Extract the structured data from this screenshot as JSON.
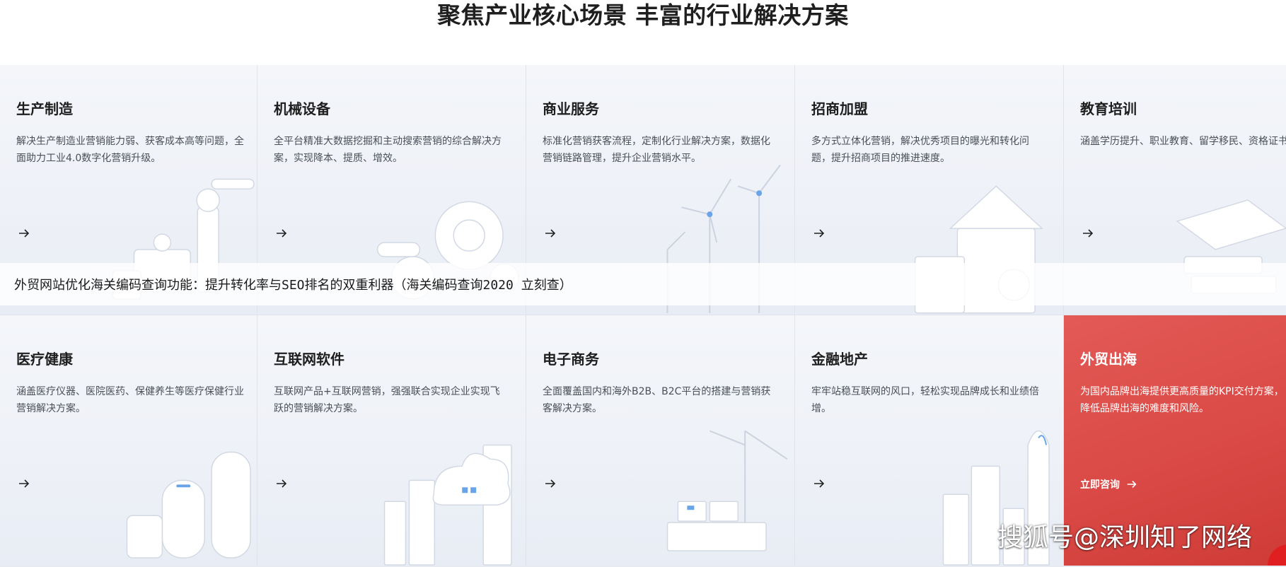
{
  "section": {
    "title": "聚焦产业核心场景 丰富的行业解决方案"
  },
  "cards": [
    {
      "title": "生产制造",
      "desc": "解决生产制造业营销能力弱、获客成本高等问题，全面助力工业4.0数字化营销升级。"
    },
    {
      "title": "机械设备",
      "desc": "全平台精准大数据挖掘和主动搜索营销的综合解决方案，实现降本、提质、增效。"
    },
    {
      "title": "商业服务",
      "desc": "标准化营销获客流程，定制化行业解决方案，数据化营销链路管理，提升企业营销水平。"
    },
    {
      "title": "招商加盟",
      "desc": "多方式立体化营销，解决优秀项目的曝光和转化问题，提升招商项目的推进速度。"
    },
    {
      "title": "教育培训",
      "desc": "涵盖学历提升、职业教育、留学移民、资格证书、教培辅导五大方向的营销解决方案。"
    },
    {
      "title": "医疗健康",
      "desc": "涵盖医疗仪器、医院医药、保健养生等医疗保健行业营销解决方案。"
    },
    {
      "title": "互联网软件",
      "desc": "互联网产品+互联网营销，强强联合实现企业实现飞跃的营销解决方案。"
    },
    {
      "title": "电子商务",
      "desc": "全面覆盖国内和海外B2B、B2C平台的搭建与营销获客解决方案。"
    },
    {
      "title": "金融地产",
      "desc": "牢牢站稳互联网的风口，轻松实现品牌成长和业绩倍增。"
    },
    {
      "title": "外贸出海",
      "desc": "为国内品牌出海提供更高质量的KPI交付方案，降低品牌出海的难度和风险。"
    }
  ],
  "highlight_card": {
    "consult_label": "立即咨询"
  },
  "overlay": {
    "headline": "外贸网站优化海关编码查询功能：提升转化率与SEO排名的双重利器（海关编码查询2020 立刻查）"
  },
  "watermark": {
    "text": "搜狐号@深圳知了网络"
  },
  "colors": {
    "accent": "#d94844",
    "card_bg": "#eef1f7",
    "title_text": "#1f1f1f"
  },
  "icons": {
    "card_arrow": "arrow-right-icon"
  }
}
